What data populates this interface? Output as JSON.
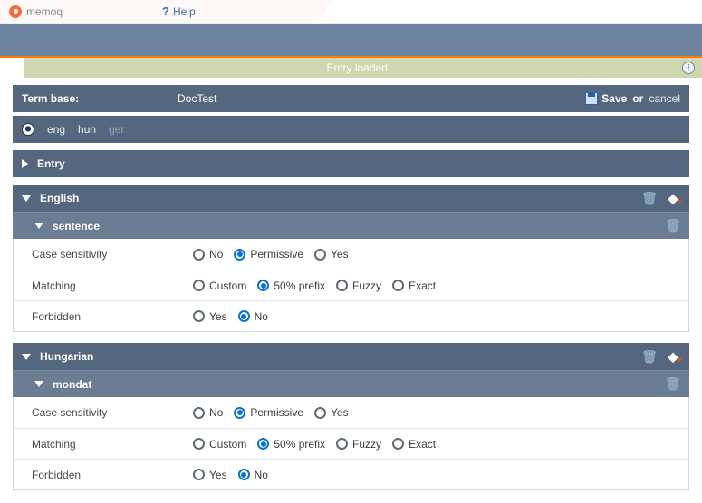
{
  "topbar": {
    "brand": "memoq",
    "help": "Help"
  },
  "status": {
    "text": "Entry loaded"
  },
  "header": {
    "label": "Term base:",
    "value": "DocTest",
    "save": "Save",
    "or": "or",
    "cancel": "cancel"
  },
  "langs": {
    "l1": "eng",
    "l2": "hun",
    "l3": "ger"
  },
  "sections": {
    "entry": "Entry",
    "english": {
      "title": "English",
      "term": "sentence",
      "rows": {
        "case": {
          "label": "Case sensitivity",
          "opts": [
            "No",
            "Permissive",
            "Yes"
          ],
          "selected": 1
        },
        "match": {
          "label": "Matching",
          "opts": [
            "Custom",
            "50% prefix",
            "Fuzzy",
            "Exact"
          ],
          "selected": 1
        },
        "forb": {
          "label": "Forbidden",
          "opts": [
            "Yes",
            "No"
          ],
          "selected": 1
        }
      }
    },
    "hungarian": {
      "title": "Hungarian",
      "term": "mondat",
      "rows": {
        "case": {
          "label": "Case sensitivity",
          "opts": [
            "No",
            "Permissive",
            "Yes"
          ],
          "selected": 1
        },
        "match": {
          "label": "Matching",
          "opts": [
            "Custom",
            "50% prefix",
            "Fuzzy",
            "Exact"
          ],
          "selected": 1
        },
        "forb": {
          "label": "Forbidden",
          "opts": [
            "Yes",
            "No"
          ],
          "selected": 1
        }
      }
    }
  }
}
